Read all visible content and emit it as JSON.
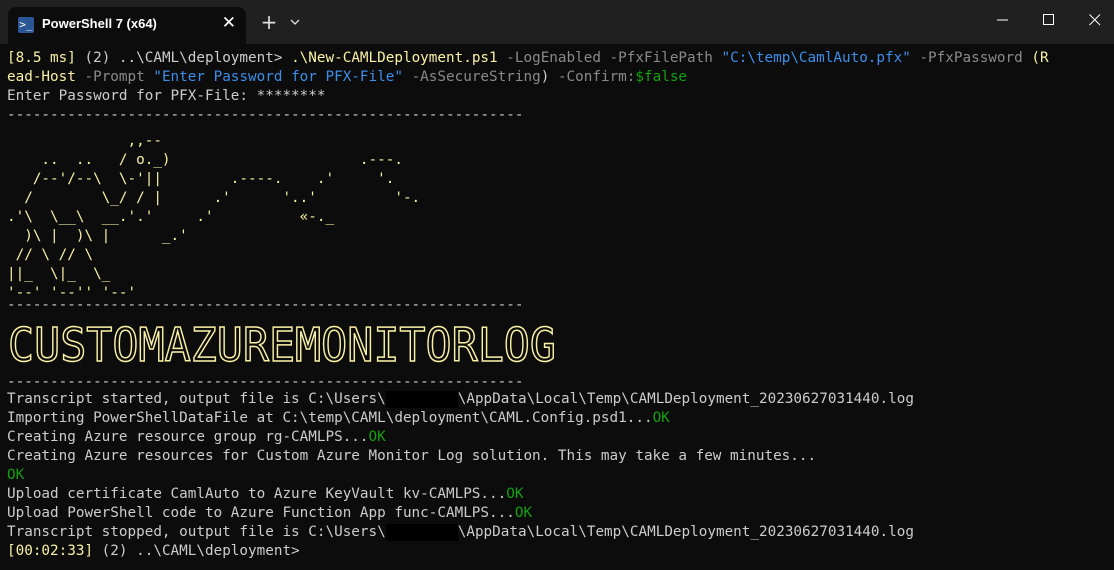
{
  "window": {
    "tab_title": "PowerShell 7 (x64)",
    "tab_icon": "powershell-icon",
    "tab_close": "✕",
    "new_tab": "+",
    "dropdown_icon": "chevron-down-icon"
  },
  "colors": {
    "background": "#0c0c0c",
    "titlebar": "#202020",
    "text": "#cccccc",
    "yellow": "#f9f1a5",
    "green": "#13a10e",
    "blue": "#3b8eea",
    "cyan": "#61d6d6"
  },
  "terminal": {
    "cmd1": {
      "time": "[8.5 ms]",
      "count": " (2) ..\\CAML\\deployment> ",
      "script": ".\\New-CAMLDeployment.ps1",
      "p1": " -LogEnabled",
      "p2": " -PfxFilePath ",
      "v2": "\"C:\\temp\\CamlAuto.pfx\"",
      "p3": " -PfxPassword ",
      "paren_open": "(R"
    },
    "cmd2": {
      "cont": "ead-Host",
      "p4": " -Prompt ",
      "v4": "\"Enter Password for PFX-File\"",
      "p5": " -AsSecureString",
      "paren_close": ") ",
      "p6": "-Confirm:",
      "v6": "$false"
    },
    "password_prompt": "Enter Password for PFX-File: ********",
    "separator": "------------------------------------------------------------",
    "ascii_art": "              ,,--\n    ..  ..   / o._)                      .---.\n   /--'/--\\  \\-'||        .----.    .'     '.\n  /        \\_/ / |      .'      '..'         '-.\n.'\\  \\__\\  __.'.'     .'          «-._\n  )\\ |  )\\ |      _.'\n // \\ // \\\n||_  \\|_  \\_\n'--' '--'' '--'",
    "banner_text": "CUSTOMAZUREMONITORLOG",
    "log": {
      "transcript_start_prefix": "Transcript started, output file is C:\\Users\\",
      "transcript_start_suffix": "\\AppData\\Local\\Temp\\CAMLDeployment_20230627031440.log",
      "import_text": "Importing PowerShellDataFile at C:\\temp\\CAML\\deployment\\CAML.Config.psd1...",
      "ok": "OK",
      "create_rg_text": "Creating Azure resource group rg-CAMLPS...",
      "create_res_text": "Creating Azure resources for Custom Azure Monitor Log solution. This may take a few minutes...",
      "upload_cert_text": "Upload certificate CamlAuto to Azure KeyVault kv-CAMLPS...",
      "upload_code_text": "Upload PowerShell code to Azure Function App func-CAMLPS...",
      "transcript_stop_prefix": "Transcript stopped, output file is C:\\Users\\",
      "transcript_stop_suffix": "\\AppData\\Local\\Temp\\CAMLDeployment_20230627031440.log"
    },
    "prompt_end": {
      "time": "[00:02:33]",
      "rest": " (2) ..\\CAML\\deployment>"
    }
  }
}
